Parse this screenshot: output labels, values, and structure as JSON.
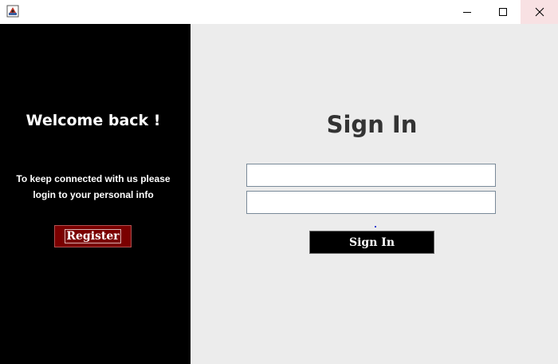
{
  "titlebar": {
    "icons": {
      "app": "java-app-icon",
      "minimize": "minimize-icon",
      "maximize": "maximize-icon",
      "close": "close-icon"
    },
    "close_hover_color": "#f8e1e3"
  },
  "left_panel": {
    "heading": "Welcome back !",
    "subtitle_line1": "To keep connected with us please",
    "subtitle_line2": "login to your personal info",
    "register_label": "Register",
    "background": "#000000",
    "register_color": "#7a0000"
  },
  "right_panel": {
    "title": "Sign In",
    "username_value": "",
    "password_value": "",
    "signin_label": "Sign In",
    "background": "#ececec"
  }
}
